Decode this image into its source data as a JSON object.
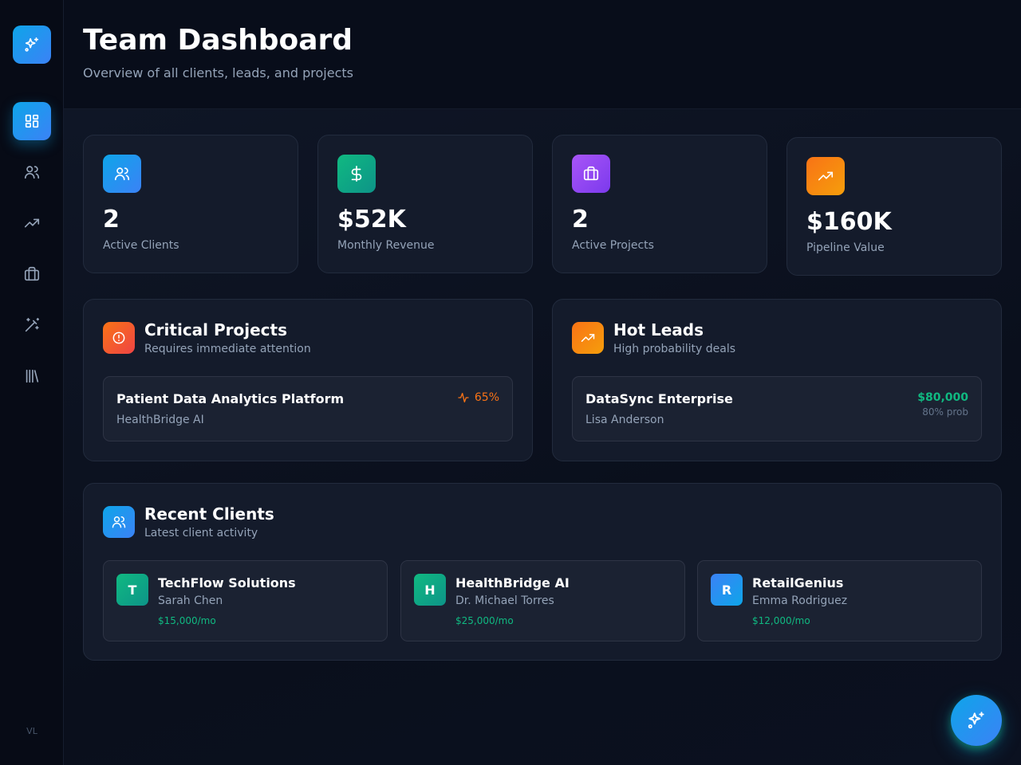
{
  "sidebar": {
    "logo_icon": "sparkles-icon",
    "nav": [
      {
        "name": "dashboard",
        "icon": "dashboard-icon",
        "active": true
      },
      {
        "name": "clients",
        "icon": "users-icon",
        "active": false
      },
      {
        "name": "leads",
        "icon": "trending-up-icon",
        "active": false
      },
      {
        "name": "projects",
        "icon": "briefcase-icon",
        "active": false
      },
      {
        "name": "ai-tools",
        "icon": "magic-wand-icon",
        "active": false
      },
      {
        "name": "library",
        "icon": "library-icon",
        "active": false
      }
    ],
    "footer": "VL"
  },
  "header": {
    "title": "Team Dashboard",
    "subtitle": "Overview of all clients, leads, and projects"
  },
  "stats": [
    {
      "value": "2",
      "label": "Active Clients",
      "icon": "users-icon",
      "color": "#0ea5e9"
    },
    {
      "value": "$52K",
      "label": "Monthly Revenue",
      "icon": "dollar-icon",
      "color": "#10b981"
    },
    {
      "value": "2",
      "label": "Active Projects",
      "icon": "briefcase-icon",
      "color": "#8b5cf6"
    },
    {
      "value": "$160K",
      "label": "Pipeline Value",
      "icon": "trending-up-icon",
      "color": "#f97316"
    }
  ],
  "critical_projects": {
    "title": "Critical Projects",
    "subtitle": "Requires immediate attention",
    "items": [
      {
        "name": "Patient Data Analytics Platform",
        "client": "HealthBridge AI",
        "progress": "65%"
      }
    ]
  },
  "hot_leads": {
    "title": "Hot Leads",
    "subtitle": "High probability deals",
    "items": [
      {
        "name": "DataSync Enterprise",
        "contact": "Lisa Anderson",
        "value": "$80,000",
        "probability": "80% prob"
      }
    ]
  },
  "recent_clients": {
    "title": "Recent Clients",
    "subtitle": "Latest client activity",
    "items": [
      {
        "initial": "T",
        "name": "TechFlow Solutions",
        "contact": "Sarah Chen",
        "revenue": "$15,000/mo",
        "color": "#10b981"
      },
      {
        "initial": "H",
        "name": "HealthBridge AI",
        "contact": "Dr. Michael Torres",
        "revenue": "$25,000/mo",
        "color": "#10b981"
      },
      {
        "initial": "R",
        "name": "RetailGenius",
        "contact": "Emma Rodriguez",
        "revenue": "$12,000/mo",
        "color": "#3b82f6"
      }
    ]
  },
  "colors": {
    "accent": "#0ea5e9",
    "success": "#10b981",
    "warning": "#f97316",
    "purple": "#8b5cf6"
  }
}
